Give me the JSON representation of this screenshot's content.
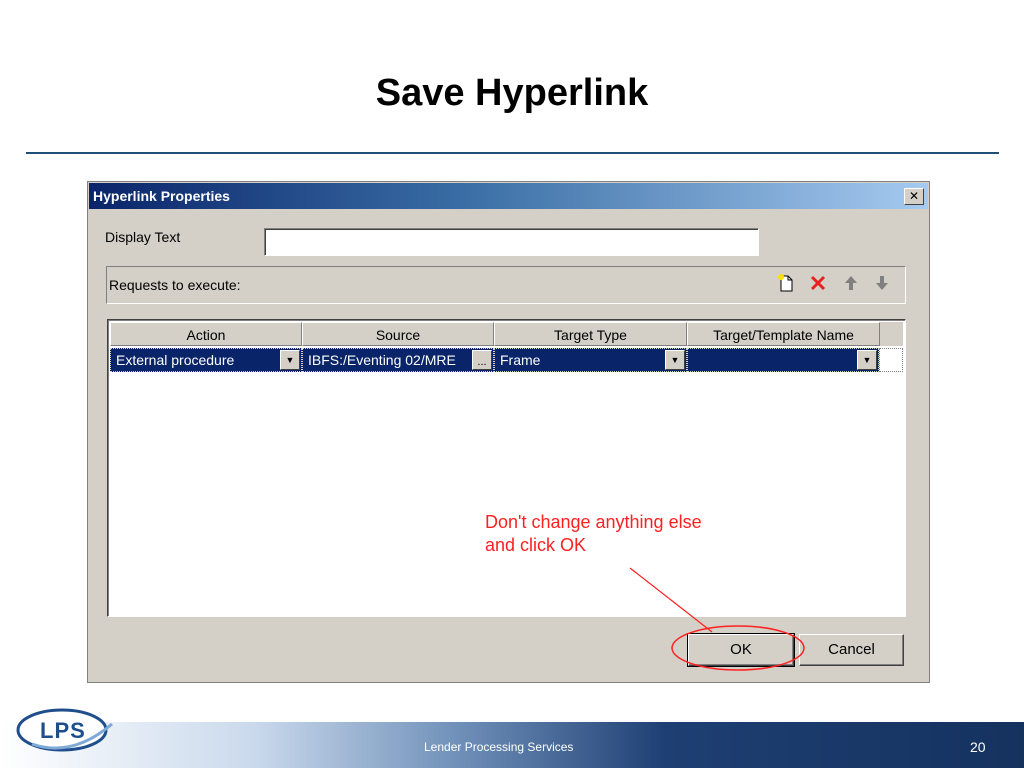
{
  "slide": {
    "title": "Save Hyperlink",
    "footer_text": "Lender Processing Services",
    "page_number": "20",
    "logo_text": "LPS"
  },
  "dialog": {
    "title": "Hyperlink Properties",
    "close_glyph": "✕",
    "display_text_label": "Display Text",
    "display_text_value": "",
    "requests_label": "Requests to execute:",
    "toolbar_icons": [
      "new-request-icon",
      "delete-icon",
      "move-up-icon",
      "move-down-icon"
    ],
    "columns": [
      "Action",
      "Source",
      "Target Type",
      "Target/Template Name"
    ],
    "rows": [
      {
        "action": "External procedure",
        "source": "IBFS:/Eventing 02/MRE",
        "target_type": "Frame",
        "target_name": ""
      }
    ],
    "browse_glyph": "...",
    "ok_label": "OK",
    "cancel_label": "Cancel"
  },
  "annotation": {
    "line1": "Don't change anything else",
    "line2": "and click OK",
    "color": "#ff2020"
  }
}
